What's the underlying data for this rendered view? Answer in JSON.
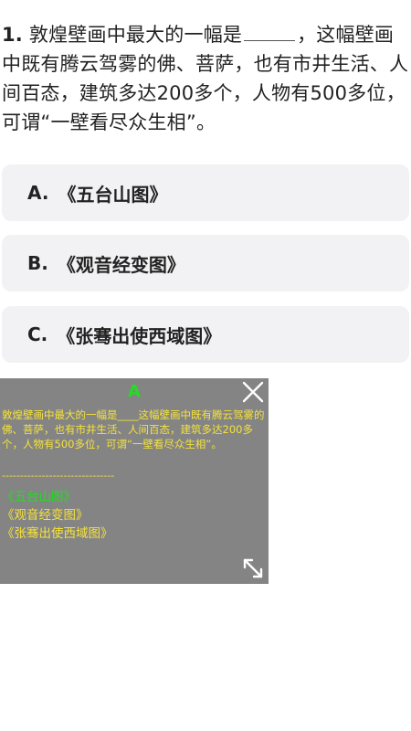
{
  "question": {
    "number": "1.",
    "text_before": "敦煌壁画中最大的一幅是",
    "text_after": "，这幅壁画中既有腾云驾雾的佛、菩萨，也有市井生活、人间百态，建筑多达200多个，人物有500多位，可谓“一壁看尽众生相”。"
  },
  "options": [
    {
      "letter": "A.",
      "text": "《五台山图》"
    },
    {
      "letter": "B.",
      "text": "《观音经变图》"
    },
    {
      "letter": "C.",
      "text": "《张骞出使西域图》"
    }
  ],
  "overlay": {
    "answer": "A",
    "body": "敦煌壁画中最大的一幅是____这幅壁画中既有腾云驾雾的佛、菩萨，也有市井生活、人间百态，建筑多达200多个，人物有500多位，可谓“一壁看尽众生相”。",
    "separator": "-------------------------------",
    "options": [
      {
        "text": "《五台山图》",
        "correct": true
      },
      {
        "text": "《观音经变图》",
        "correct": false
      },
      {
        "text": "《张骞出使西域图》",
        "correct": false
      }
    ],
    "icons": {
      "close": "close-icon",
      "resize": "expand-icon"
    },
    "colors": {
      "correct": "#22dd22",
      "text": "#f5e23a",
      "background": "#808080"
    }
  }
}
